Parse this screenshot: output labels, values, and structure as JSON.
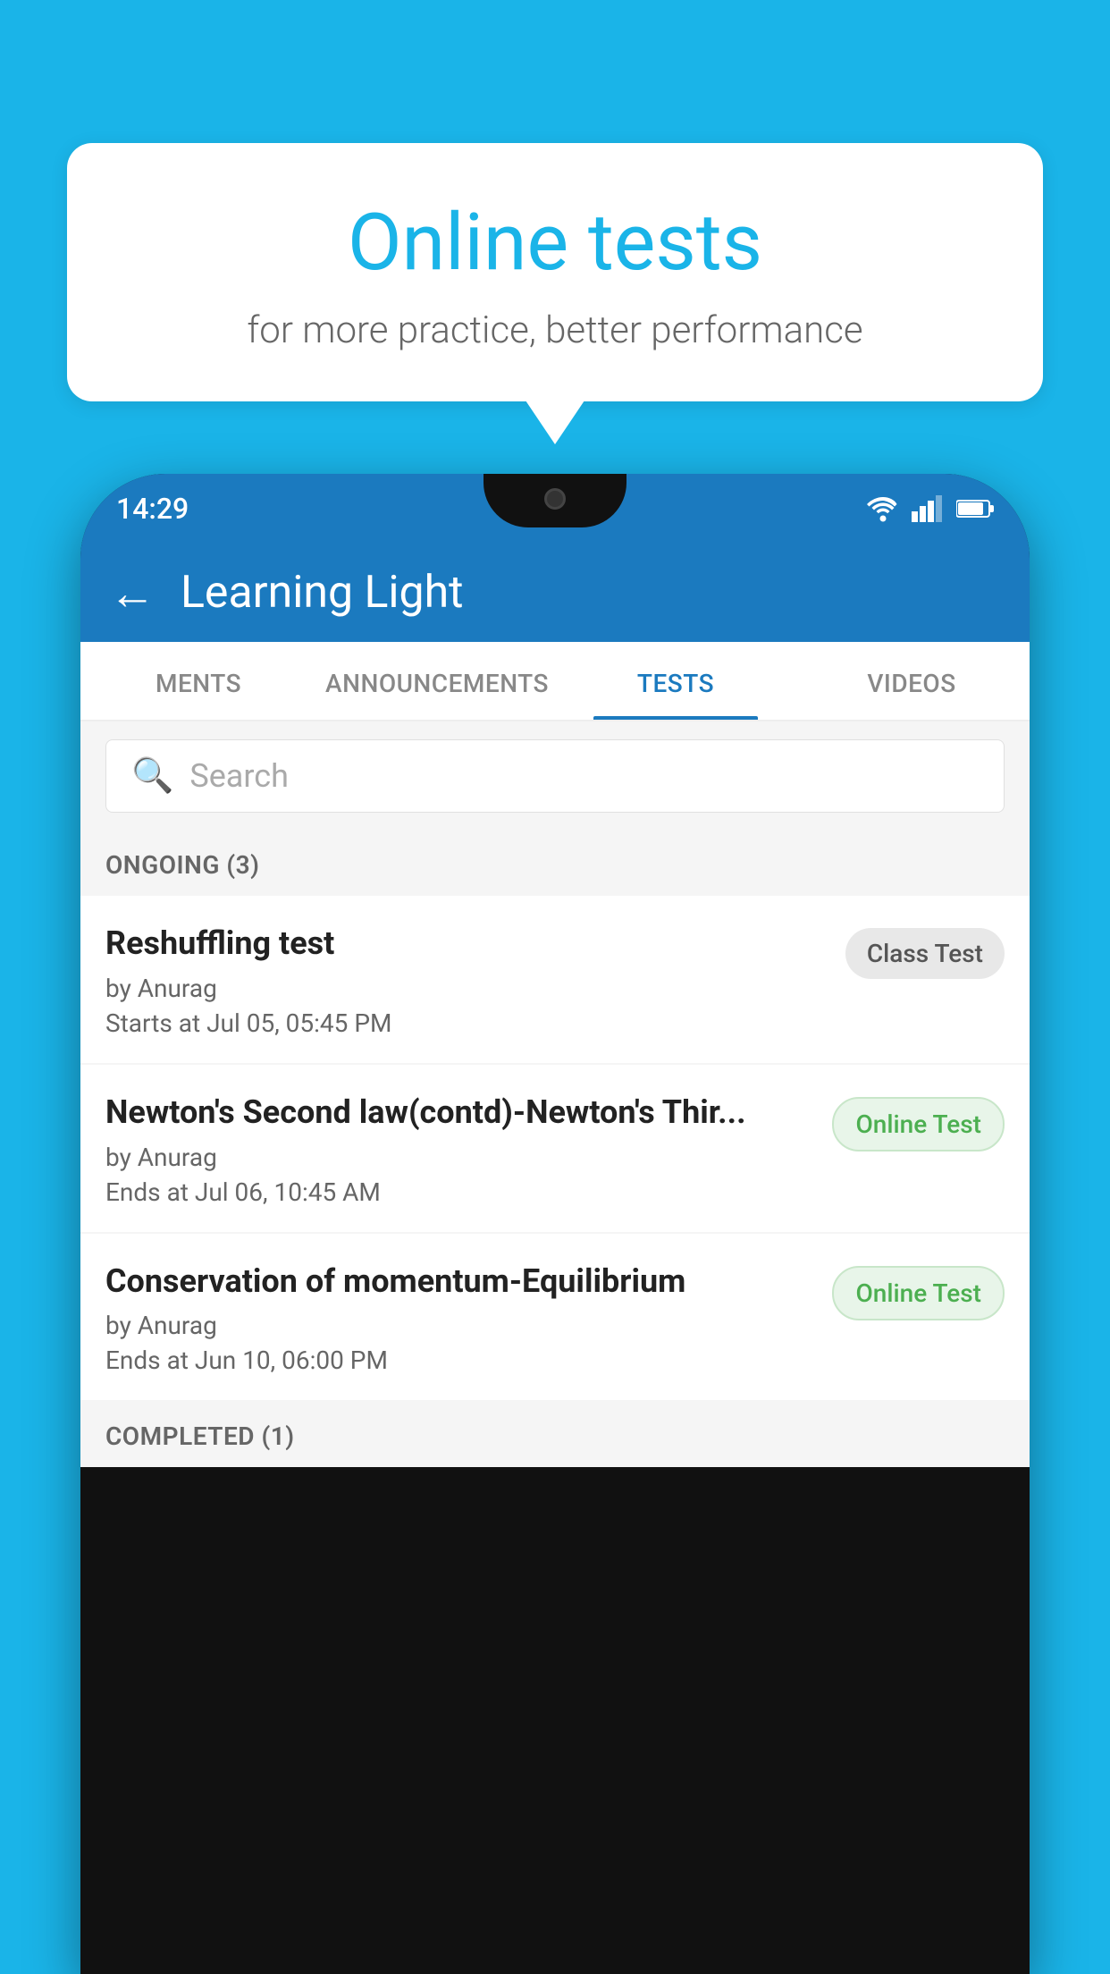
{
  "background": {
    "color": "#1ab4e8"
  },
  "speech_bubble": {
    "title": "Online tests",
    "subtitle": "for more practice, better performance"
  },
  "phone": {
    "status_bar": {
      "time": "14:29",
      "wifi": "wifi",
      "signal": "signal",
      "battery": "battery"
    },
    "app_bar": {
      "back_label": "←",
      "title": "Learning Light"
    },
    "tabs": [
      {
        "label": "MENTS",
        "active": false
      },
      {
        "label": "ANNOUNCEMENTS",
        "active": false
      },
      {
        "label": "TESTS",
        "active": true
      },
      {
        "label": "VIDEOS",
        "active": false
      }
    ],
    "search": {
      "placeholder": "Search"
    },
    "section_ongoing": {
      "label": "ONGOING (3)"
    },
    "tests_ongoing": [
      {
        "name": "Reshuffling test",
        "by": "by Anurag",
        "time": "Starts at  Jul 05, 05:45 PM",
        "badge": "Class Test",
        "badge_type": "class"
      },
      {
        "name": "Newton's Second law(contd)-Newton's Thir...",
        "by": "by Anurag",
        "time": "Ends at  Jul 06, 10:45 AM",
        "badge": "Online Test",
        "badge_type": "online"
      },
      {
        "name": "Conservation of momentum-Equilibrium",
        "by": "by Anurag",
        "time": "Ends at  Jun 10, 06:00 PM",
        "badge": "Online Test",
        "badge_type": "online"
      }
    ],
    "section_completed": {
      "label": "COMPLETED (1)"
    }
  }
}
